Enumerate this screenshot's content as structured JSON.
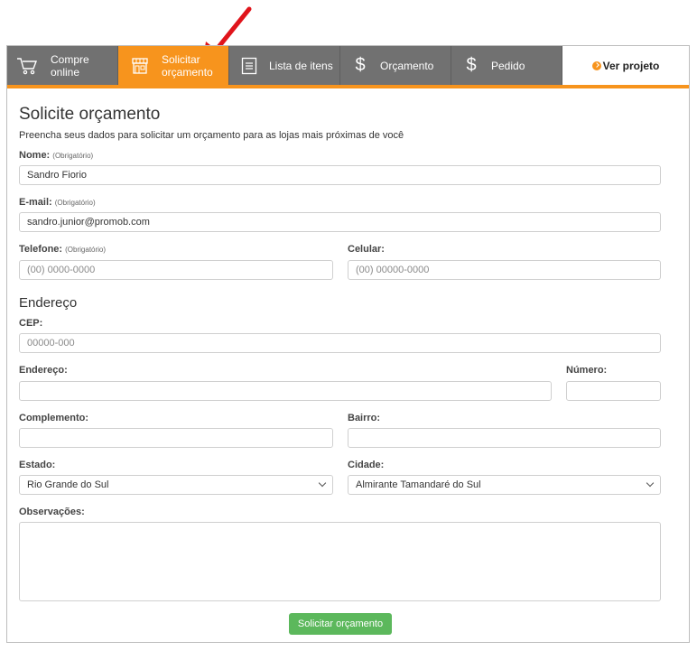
{
  "nav": {
    "items": [
      {
        "label_line1": "Compre",
        "label_line2": "online",
        "icon": "cart-icon"
      },
      {
        "label_line1": "Solicitar",
        "label_line2": "orçamento",
        "icon": "store-icon",
        "active": true
      },
      {
        "label": "Lista de itens",
        "icon": "list-icon"
      },
      {
        "label": "Orçamento",
        "icon": "dollar-icon"
      },
      {
        "label": "Pedido",
        "icon": "dollar-icon"
      }
    ],
    "view_project": "Ver projeto",
    "accent_color": "#f7941d"
  },
  "form": {
    "title": "Solicite orçamento",
    "subtitle": "Preencha seus dados para solicitar um orçamento para as lojas mais próximas de você",
    "required_note": "(Obrigatório)",
    "name_label": "Nome:",
    "name_value": "Sandro Fiorio",
    "email_label": "E-mail:",
    "email_value": "sandro.junior@promob.com",
    "phone_label": "Telefone:",
    "phone_placeholder": "(00) 0000-0000",
    "mobile_label": "Celular:",
    "mobile_placeholder": "(00) 00000-0000",
    "address_section": "Endereço",
    "cep_label": "CEP:",
    "cep_placeholder": "00000-000",
    "address_label": "Endereço:",
    "number_label": "Número:",
    "complement_label": "Complemento:",
    "district_label": "Bairro:",
    "state_label": "Estado:",
    "state_value": "Rio Grande do Sul",
    "city_label": "Cidade:",
    "city_value": "Almirante Tamandaré do Sul",
    "notes_label": "Observações:",
    "submit_label": "Solicitar orçamento",
    "submit_color": "#5cb85c"
  }
}
